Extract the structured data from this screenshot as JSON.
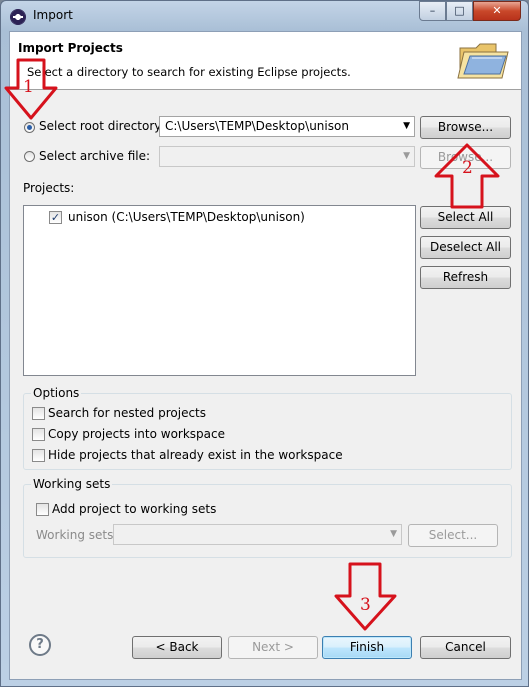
{
  "window": {
    "title": "Import",
    "controls": {
      "minimize": "–",
      "maximize": "□",
      "close": "✕"
    }
  },
  "banner": {
    "title": "Import Projects",
    "description": "Select a directory to search for existing Eclipse projects.",
    "icon": "folder-icon"
  },
  "source": {
    "root_label": "Select root directory:",
    "root_value": "C:\\Users\\TEMP\\Desktop\\unison",
    "root_selected": true,
    "archive_label": "Select archive file:",
    "archive_value": "",
    "browse_root": "Browse...",
    "browse_archive": "Browse..."
  },
  "projects": {
    "label": "Projects:",
    "items": [
      {
        "label": "unison (C:\\Users\\TEMP\\Desktop\\unison)",
        "checked": true
      }
    ],
    "select_all": "Select All",
    "deselect_all": "Deselect All",
    "refresh": "Refresh"
  },
  "options": {
    "title": "Options",
    "items": [
      {
        "label": "Search for nested projects",
        "checked": false
      },
      {
        "label": "Copy projects into workspace",
        "checked": false
      },
      {
        "label": "Hide projects that already exist in the workspace",
        "checked": false
      }
    ]
  },
  "working_sets": {
    "title": "Working sets",
    "add_label": "Add project to working sets",
    "add_checked": false,
    "sets_label": "Working sets:",
    "select_button": "Select..."
  },
  "footer": {
    "help": "?",
    "back": "< Back",
    "next": "Next >",
    "finish": "Finish",
    "cancel": "Cancel"
  },
  "annotations": [
    {
      "number": "1",
      "direction": "down",
      "color": "#d6121c"
    },
    {
      "number": "2",
      "direction": "up",
      "color": "#d6121c"
    },
    {
      "number": "3",
      "direction": "down",
      "color": "#d6121c"
    }
  ],
  "check_mark": "✓",
  "dropdown_arrow": "▼"
}
